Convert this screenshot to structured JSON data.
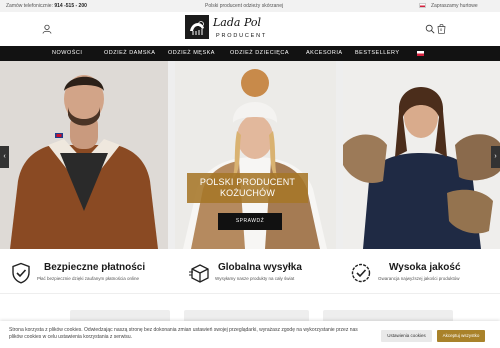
{
  "topbar": {
    "phone_label": "Zamów telefonicznie:",
    "phone_number": "914 -515 - 200",
    "promo": "Polski producent odzieży skórzanej",
    "wholesale": "Zapraszamy hurtowe"
  },
  "header": {
    "logo_script": "Lada Pol",
    "logo_sub": "PRODUCENT",
    "cart_count": "0"
  },
  "nav": {
    "items": [
      "NOWOŚCI",
      "ODZIEŻ DAMSKA",
      "ODZIEŻ MĘSKA",
      "ODZIEŻ DZIECIĘCA",
      "AKCESORIA",
      "BESTSELLERY"
    ]
  },
  "hero": {
    "title_line1": "POLSKI PRODUCENT",
    "title_line2": "KOŻUCHÓW",
    "button": "SPRAWDŹ",
    "prev": "‹",
    "next": "›"
  },
  "features": [
    {
      "title": "Bezpieczne płatności",
      "sub": "Płać bezpiecznie dzięki zaufanym płatnościa online",
      "icon": "shield-check-icon"
    },
    {
      "title": "Globalna wysyłka",
      "sub": "Wysyłamy nasze produkty na cały świat",
      "icon": "shipping-box-icon"
    },
    {
      "title": "Wysoka jakość",
      "sub": "Gwarancja najwyższej jakości produktów",
      "icon": "quality-badge-icon"
    }
  ],
  "cookie": {
    "text": "Strona korzysta z plików cookies. Odwiedzając naszą stronę bez dokonania zmian ustawień swojej przeglądarki, wyrażasz zgodę na wykorzystanie przez nas plików cookies w celu ustawienia korzystania z serwisu.",
    "settings_button": "Ustawienia cookies",
    "accept_button": "Akceptuj wszystko"
  },
  "colors": {
    "accent_gold": "#a9822a",
    "nav_bg": "#121212"
  }
}
